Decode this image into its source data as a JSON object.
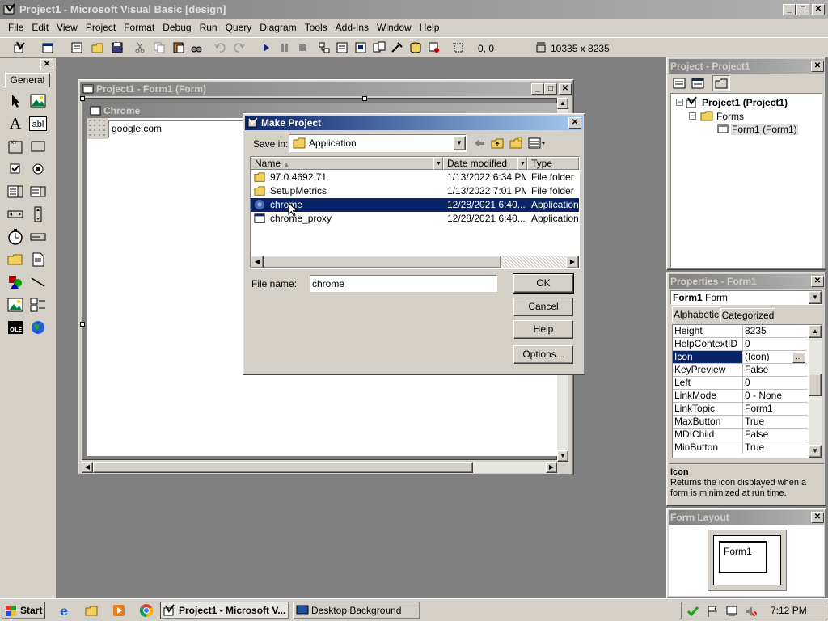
{
  "app": {
    "title": "Project1 - Microsoft Visual Basic [design]",
    "menu": [
      "File",
      "Edit",
      "View",
      "Project",
      "Format",
      "Debug",
      "Run",
      "Query",
      "Diagram",
      "Tools",
      "Add-Ins",
      "Window",
      "Help"
    ],
    "toolbar": {
      "position": "0, 0",
      "size": "10335 x 8235"
    }
  },
  "toolbox": {
    "tab": "General"
  },
  "form_window": {
    "title": "Project1 - Form1 (Form)",
    "form_caption": "Chrome",
    "textbox_value": "google.com"
  },
  "dialog": {
    "title": "Make Project",
    "save_in_label": "Save in:",
    "save_in_value": "Application",
    "columns": [
      "Name",
      "Date modified",
      "Type"
    ],
    "files": [
      {
        "name": "97.0.4692.71",
        "date": "1/13/2022 6:34 PM",
        "type": "File folder"
      },
      {
        "name": "SetupMetrics",
        "date": "1/13/2022 7:01 PM",
        "type": "File folder"
      },
      {
        "name": "chrome",
        "date": "12/28/2021 6:40...",
        "type": "Application"
      },
      {
        "name": "chrome_proxy",
        "date": "12/28/2021 6:40...",
        "type": "Application"
      }
    ],
    "filename_label": "File name:",
    "filename_value": "chrome",
    "buttons": {
      "ok": "OK",
      "cancel": "Cancel",
      "help": "Help",
      "options": "Options..."
    }
  },
  "project_panel": {
    "title": "Project - Project1",
    "root": "Project1 (Project1)",
    "folder": "Forms",
    "item": "Form1 (Form1)"
  },
  "properties_panel": {
    "title": "Properties - Form1",
    "object_name": "Form1",
    "object_type": "Form",
    "tabs": [
      "Alphabetic",
      "Categorized"
    ],
    "rows": [
      {
        "name": "Height",
        "value": "8235"
      },
      {
        "name": "HelpContextID",
        "value": "0"
      },
      {
        "name": "Icon",
        "value": "(Icon)"
      },
      {
        "name": "KeyPreview",
        "value": "False"
      },
      {
        "name": "Left",
        "value": "0"
      },
      {
        "name": "LinkMode",
        "value": "0 - None"
      },
      {
        "name": "LinkTopic",
        "value": "Form1"
      },
      {
        "name": "MaxButton",
        "value": "True"
      },
      {
        "name": "MDIChild",
        "value": "False"
      },
      {
        "name": "MinButton",
        "value": "True"
      }
    ],
    "desc_title": "Icon",
    "desc_text": "Returns the icon displayed when a form is minimized at run time."
  },
  "form_layout": {
    "title": "Form Layout",
    "form_label": "Form1"
  },
  "taskbar": {
    "start": "Start",
    "tasks": [
      "Project1 - Microsoft V...",
      "Desktop Background"
    ],
    "clock": "7:12 PM"
  },
  "colors": {
    "active_title": "#0a246a",
    "face": "#d4d0c8",
    "workspace": "#808080"
  }
}
